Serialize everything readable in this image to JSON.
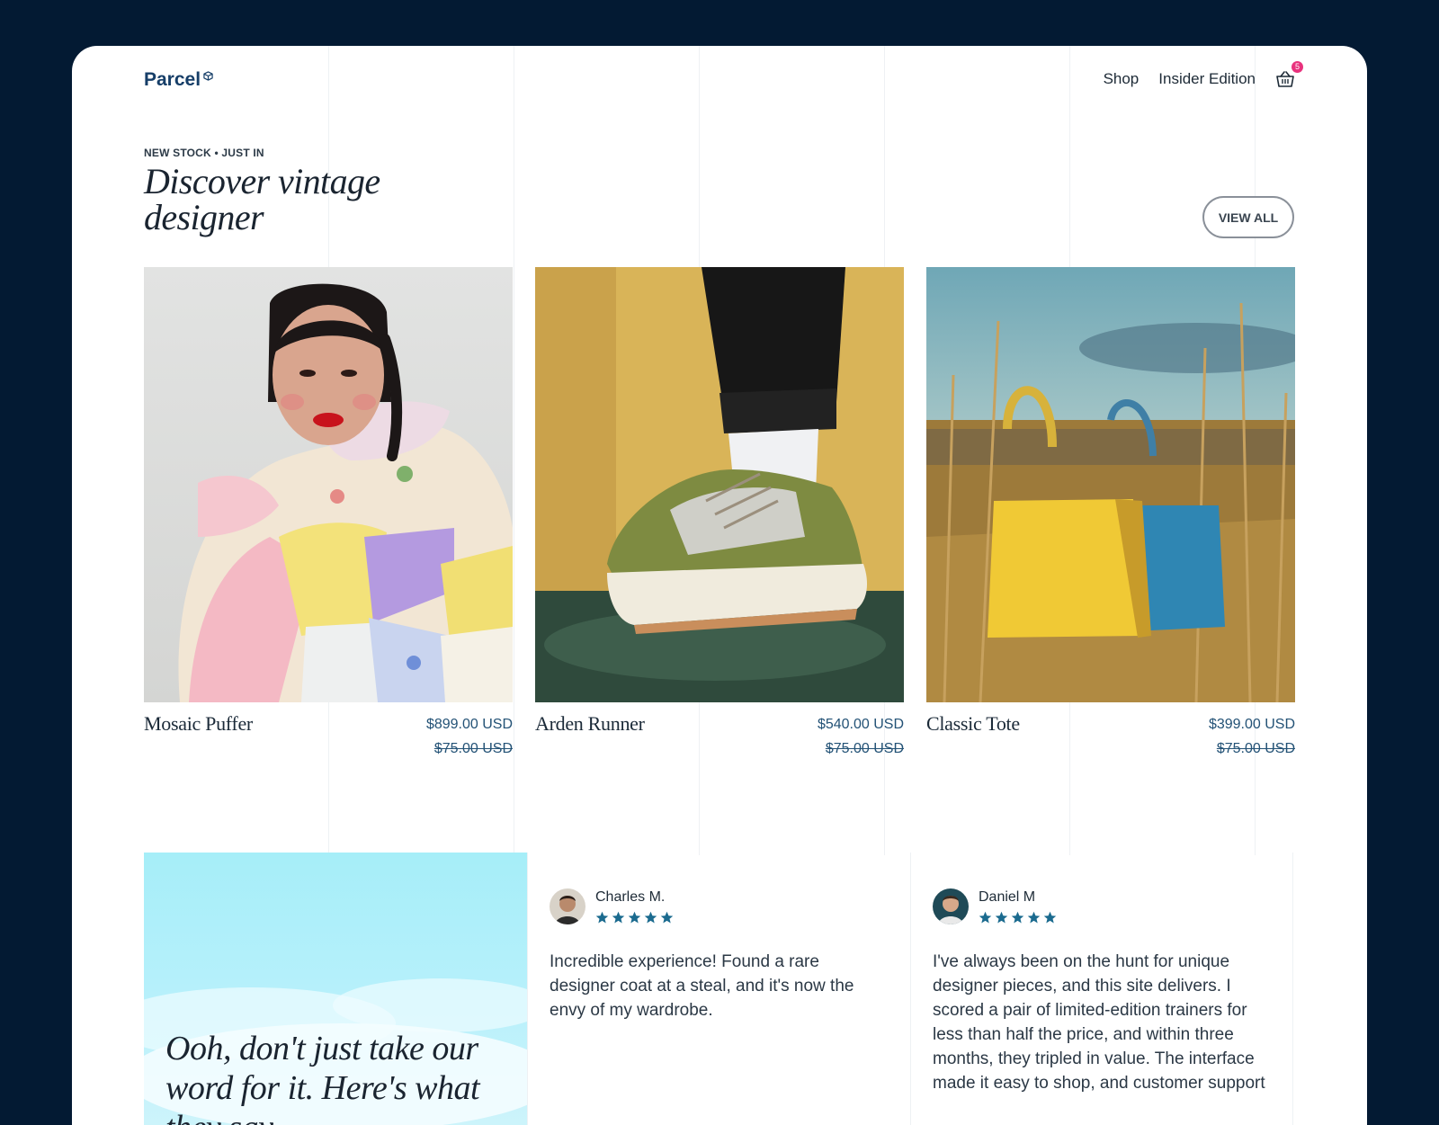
{
  "brand": {
    "name": "Parcel"
  },
  "nav": {
    "shop": "Shop",
    "insider": "Insider Edition",
    "cart_count": "5"
  },
  "section": {
    "eyebrow": "NEW STOCK • JUST IN",
    "title": "Discover vintage designer",
    "view_all": "VIEW ALL"
  },
  "products": [
    {
      "name": "Mosaic Puffer",
      "price": "$899.00 USD",
      "old_price": "$75.00 USD"
    },
    {
      "name": "Arden Runner",
      "price": "$540.00 USD",
      "old_price": "$75.00 USD"
    },
    {
      "name": "Classic Tote",
      "price": "$399.00 USD",
      "old_price": "$75.00 USD"
    }
  ],
  "testimonials": {
    "headline": "Ooh, don't just take our word for it. Here's what they say",
    "rating_stars": 5,
    "items": [
      {
        "name": "Charles M.",
        "text": "Incredible experience! Found a rare designer coat at a steal, and it's now the envy of my wardrobe."
      },
      {
        "name": "Daniel M",
        "text": "I've always been on the hunt for unique designer pieces, and this site delivers. I scored a pair of limited-edition trainers for less than half the price, and within three months, they tripled in value. The interface made it easy to shop, and customer support"
      }
    ]
  },
  "colors": {
    "page_bg": "#031a33",
    "brand": "#163e68",
    "accent_badge": "#e8327d",
    "star": "#1b6b8f",
    "price": "#235276"
  }
}
